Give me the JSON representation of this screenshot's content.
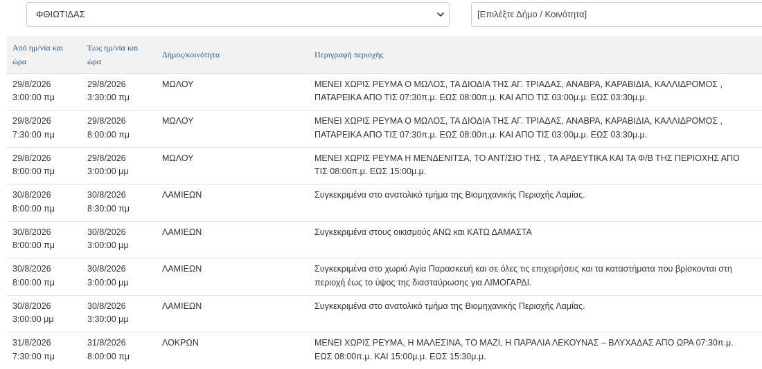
{
  "filters": {
    "prefecture_value": "ΦΘΙΩΤΙΔΑΣ",
    "municipality_placeholder": "[Επιλέξτε Δήμο / Κοινότητα]"
  },
  "table": {
    "headers": {
      "from": "Από ημ/νία και ώρα",
      "to": "Έως ημ/νία και ώρα",
      "municipality": "Δήμος/κοινότητα",
      "description": "Περιγραφή περιοχής"
    },
    "rows": [
      {
        "from_date": "29/8/2026",
        "from_time": "3:00:00 πμ",
        "to_date": "29/8/2026",
        "to_time": "3:30:00 πμ",
        "municipality": "ΜΩΛΟΥ",
        "description": "ΜΕΝΕΙ ΧΩΡΙΣ ΡΕΥΜΑ Ο ΜΩΛΟΣ, ΤΑ ΔΙΟΔΙΑ ΤΗΣ ΑΓ. ΤΡΙΑΔΑΣ, ΑΝΑΒΡΑ, ΚΑΡΑΒΙΔΙΑ, ΚΑΛΛΙΔΡΟΜΟΣ , ΠΑΤΑΡΕΙΚΑ ΑΠΟ ΤΙΣ 07:30π.μ. ΕΩΣ 08:00π.μ. ΚΑΙ ΑΠΟ ΤΙΣ 03:00μ.μ. ΕΩΣ 03:30μ.μ."
      },
      {
        "from_date": "29/8/2026",
        "from_time": "7:30:00 πμ",
        "to_date": "29/8/2026",
        "to_time": "8:00:00 πμ",
        "municipality": "ΜΩΛΟΥ",
        "description": "ΜΕΝΕΙ ΧΩΡΙΣ ΡΕΥΜΑ Ο ΜΩΛΟΣ, ΤΑ ΔΙΟΔΙΑ ΤΗΣ ΑΓ. ΤΡΙΑΔΑΣ, ΑΝΑΒΡΑ, ΚΑΡΑΒΙΔΙΑ, ΚΑΛΛΙΔΡΟΜΟΣ , ΠΑΤΑΡΕΙΚΑ ΑΠΟ ΤΙΣ 07:30π.μ. ΕΩΣ 08:00π.μ. ΚΑΙ ΑΠΟ ΤΙΣ 03:00μ.μ. ΕΩΣ 03:30μ.μ."
      },
      {
        "from_date": "29/8/2026",
        "from_time": "8:00:00 πμ",
        "to_date": "29/8/2026",
        "to_time": "3:00:00 μμ",
        "municipality": "ΜΩΛΟΥ",
        "description": "ΜΕΝΕΙ ΧΩΡΙΣ ΡΕΥΜΑ Η ΜΕΝΔΕΝΙΤΣΑ, ΤΟ ΑΝΤ/ΣΙΟ ΤΗΣ , ΤΑ ΑΡΔΕΥΤΙΚΑ ΚΑΙ ΤΑ Φ/Β ΤΗΣ ΠΕΡΙΟΧΗΣ ΑΠΟ ΤΙΣ 08:00π.μ. ΕΩΣ 15:00μ.μ."
      },
      {
        "from_date": "30/8/2026",
        "from_time": "8:00:00 πμ",
        "to_date": "30/8/2026",
        "to_time": "8:30:00 πμ",
        "municipality": "ΛΑΜΙΕΩΝ",
        "description": "Συγκεκριμένα στο ανατολικό τμήμα της Βιομηχανικής Περιοχής Λαμίας."
      },
      {
        "from_date": "30/8/2026",
        "from_time": "8:00:00 πμ",
        "to_date": "30/8/2026",
        "to_time": "3:00:00 μμ",
        "municipality": "ΛΑΜΙΕΩΝ",
        "description": "Συγκεκριμένα στους οικισμούς ΑΝΩ και ΚΑΤΩ ΔΑΜΑΣΤΑ"
      },
      {
        "from_date": "30/8/2026",
        "from_time": "8:00:00 πμ",
        "to_date": "30/8/2026",
        "to_time": "3:00:00 μμ",
        "municipality": "ΛΑΜΙΕΩΝ",
        "description": "Συγκεκριμένα στο χωριό Αγία Παρασκευή και σε όλες τις επιχειρήσεις και τα καταστήματα που βρίσκονται στη περιοχή έως το ύψος της διασταύρωσης για ΛΙΜΟΓΑΡΔΙ."
      },
      {
        "from_date": "30/8/2026",
        "from_time": "3:00:00 μμ",
        "to_date": "30/8/2026",
        "to_time": "3:30:00 μμ",
        "municipality": "ΛΑΜΙΕΩΝ",
        "description": "Συγκεκριμένα στο ανατολικό τμήμα της Βιομηχανικής Περιοχής Λαμίας."
      },
      {
        "from_date": "31/8/2026",
        "from_time": "7:30:00 πμ",
        "to_date": "31/8/2026",
        "to_time": "8:00:00 πμ",
        "municipality": "ΛΟΚΡΩΝ",
        "description": "ΜΕΝΕΙ ΧΩΡΙΣ ΡΕΥΜΑ, Η ΜΑΛΕΣΙΝΑ, ΤΟ ΜΑΖΙ, Η ΠΑΡΑΛΙΑ ΛΕΚΟΥΝΑΣ – ΒΛΥΧΑΔΑΣ ΑΠΟ ΩΡΑ 07:30π.μ. ΕΩΣ 08:00π.μ. ΚΑΙ 15:00μ.μ. ΕΩΣ 15:30μ.μ."
      }
    ]
  }
}
